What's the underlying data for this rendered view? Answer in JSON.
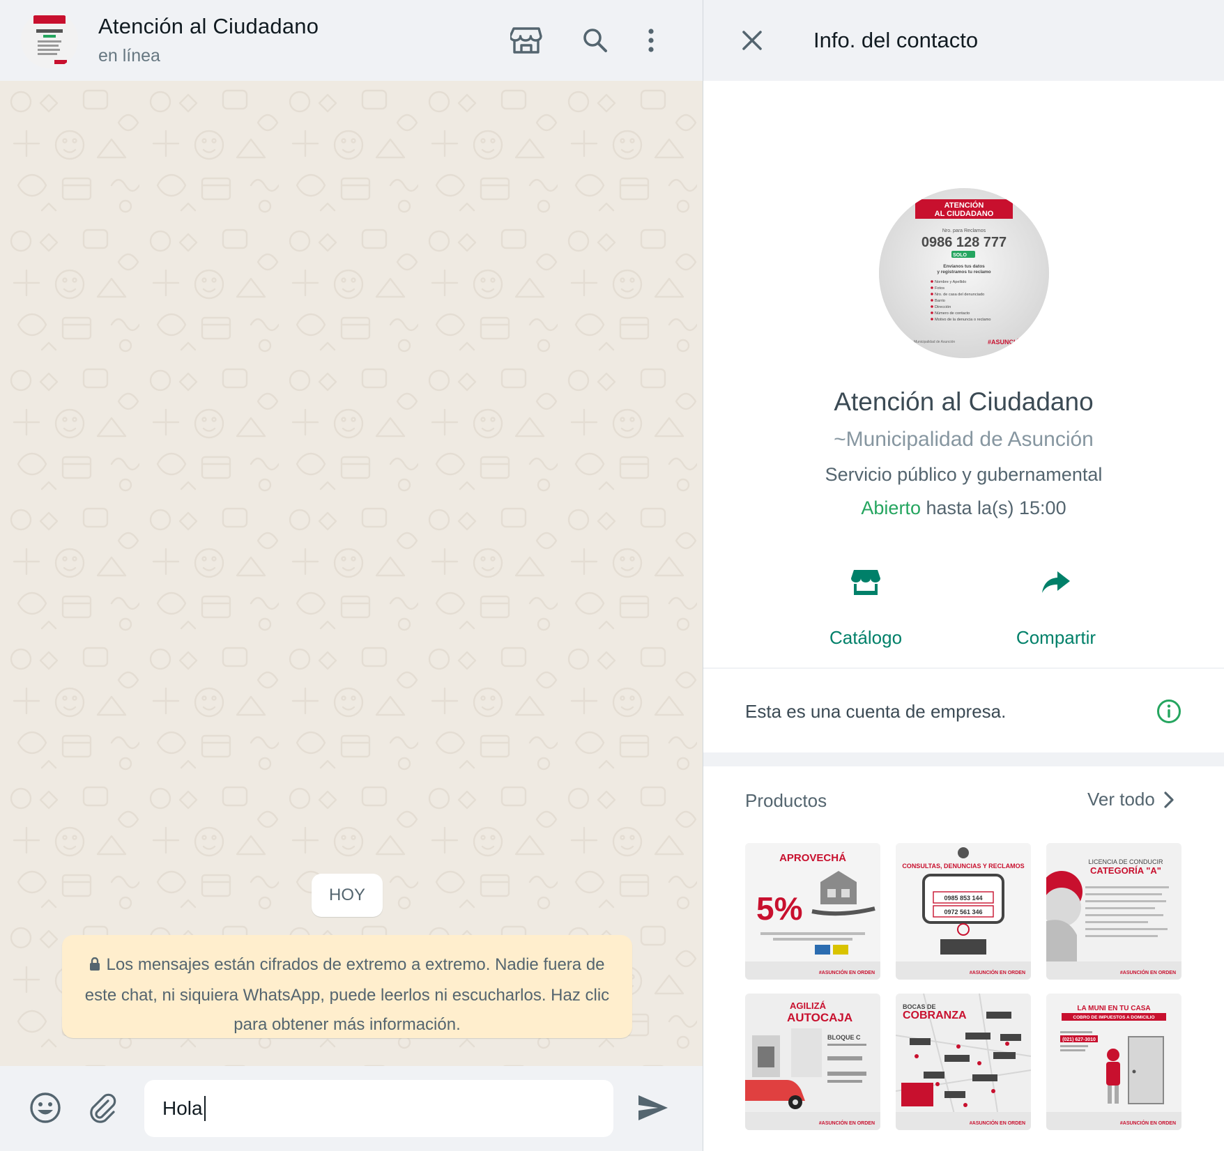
{
  "chat": {
    "contact_name": "Atención al Ciudadano",
    "status": "en línea",
    "day_chip": "HOY",
    "encryption_notice": "Los mensajes están cifrados de extremo a extremo. Nadie fuera de este chat, ni siquiera WhatsApp, puede leerlos ni escucharlos. Haz clic para obtener más información.",
    "composer_value": "Hola",
    "icons": {
      "catalog": "storefront-icon",
      "search": "search-icon",
      "menu": "more-vertical-icon",
      "emoji": "emoji-icon",
      "attach": "paperclip-icon",
      "send": "send-icon"
    }
  },
  "avatar": {
    "badge_line1": "ATENCIÓN",
    "badge_line2": "AL CIUDADANO",
    "caption": "Nro. para Reclamos",
    "phone": "0986 128 777",
    "solo": "SOLO",
    "intro_line1": "Envíanos tus datos",
    "intro_line2": "y registramos tu reclamo",
    "list": [
      "Nombre y Apellido",
      "Fotos",
      "Nro. de casa del denunciado",
      "Barrio",
      "Dirección",
      "Número de contacto",
      "Motivo de la denuncia o reclamo"
    ],
    "footer_left": "Municipalidad de Asunción",
    "footer_right": "#ASUNCIÓN EN ORDEN"
  },
  "info": {
    "title": "Info. del contacto",
    "name": "Atención al Ciudadano",
    "push_name": "~Municipalidad de Asunción",
    "category": "Servicio público y gubernamental",
    "hours_status": "Abierto",
    "hours_rest": " hasta la(s) 15:00",
    "actions": [
      {
        "label": "Catálogo",
        "icon": "storefront-icon"
      },
      {
        "label": "Compartir",
        "icon": "share-arrow-icon"
      }
    ],
    "business_notice": "Esta es una cuenta de empresa.",
    "products_title": "Productos",
    "see_all": "Ver todo",
    "accent_color": "#008069",
    "open_color": "#25a55f"
  },
  "products": [
    {
      "title": "APROVECHÁ",
      "line2": "5%",
      "line3": "",
      "footer": "#ASUNCIÓN EN ORDEN"
    },
    {
      "title": "CONSULTAS, DENUNCIAS Y RECLAMOS",
      "line2": "0985 853 144",
      "line3": "0972 561 346",
      "footer": "#ASUNCIÓN EN ORDEN"
    },
    {
      "title": "LICENCIA DE CONDUCIR",
      "line2": "CATEGORÍA \"A\"",
      "line3": "",
      "footer": "#ASUNCIÓN EN ORDEN"
    },
    {
      "title": "AGILIZÁ",
      "line2": "AUTOCAJA",
      "line3": "BLOQUE C",
      "footer": "#ASUNCIÓN EN ORDEN"
    },
    {
      "title": "BOCAS DE",
      "line2": "COBRANZA",
      "line3": "",
      "footer": "#ASUNCIÓN EN ORDEN"
    },
    {
      "title": "LA MUNI EN TU CASA",
      "line2": "COBRO DE IMPUESTOS A DOMICILIO",
      "line3": "(021) 627-3010",
      "footer": "#ASUNCIÓN EN ORDEN"
    }
  ]
}
